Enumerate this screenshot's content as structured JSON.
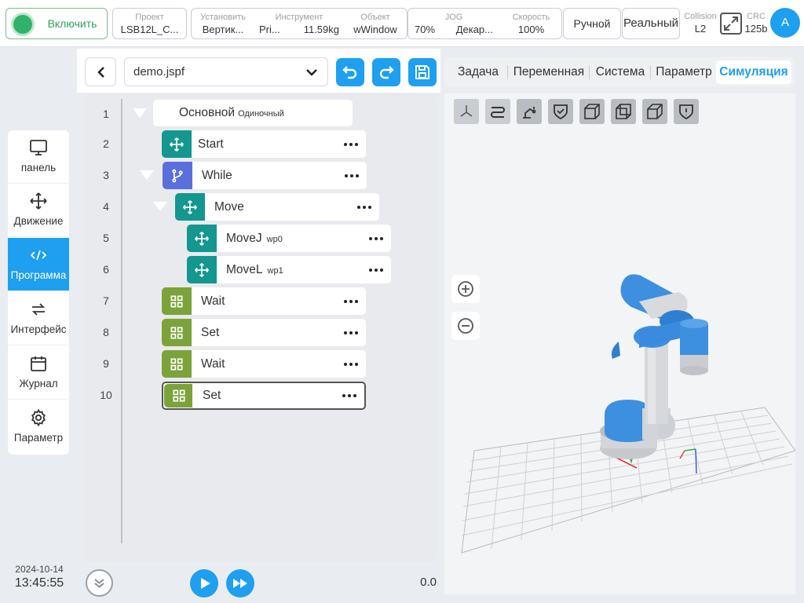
{
  "topbar": {
    "power_label": "Включить",
    "project": {
      "key": "Проект",
      "value": "LSB12L_C..."
    },
    "install": {
      "key": "Установить",
      "value": "Вертик..."
    },
    "tool": {
      "key": "Инструмент",
      "value_a": "Pri...",
      "value_b": "11.59kg"
    },
    "object": {
      "key": "Объект",
      "value": "wWindow"
    },
    "jog": {
      "key": "JOG",
      "value_a": "70%",
      "value_b": "Декар..."
    },
    "speed": {
      "key": "Скорость",
      "value": "100%"
    },
    "mode_label": "Ручной",
    "real_label": "Реальный",
    "collision": {
      "key": "Collision",
      "value": "L2"
    },
    "crc": {
      "key": "CRC",
      "value": "125b"
    },
    "avatar_letter": "A"
  },
  "nav": {
    "items": [
      {
        "label": "панель",
        "icon": "monitor-icon"
      },
      {
        "label": "Движение",
        "icon": "move-icon"
      },
      {
        "label": "Программа",
        "icon": "code-icon"
      },
      {
        "label": "Интерфейс",
        "icon": "swap-icon"
      },
      {
        "label": "Журнал",
        "icon": "calendar-icon"
      },
      {
        "label": "Параметр",
        "icon": "gear-icon"
      }
    ],
    "active": "Программа"
  },
  "datetime": {
    "date": "2024-10-14",
    "time": "13:45:55"
  },
  "editor": {
    "file_name": "demo.jspf",
    "line_numbers": [
      "1",
      "2",
      "3",
      "4",
      "5",
      "6",
      "7",
      "8",
      "9",
      "10"
    ],
    "root": {
      "label": "Основной",
      "sub": "Одиночный"
    },
    "nodes": [
      {
        "label": "Start",
        "sub": ""
      },
      {
        "label": "While",
        "sub": ""
      },
      {
        "label": "Move",
        "sub": ""
      },
      {
        "label": "MoveJ",
        "sub": "wp0"
      },
      {
        "label": "MoveL",
        "sub": "wp1"
      },
      {
        "label": "Wait",
        "sub": ""
      },
      {
        "label": "Set",
        "sub": ""
      },
      {
        "label": "Wait",
        "sub": ""
      },
      {
        "label": "Set",
        "sub": ""
      }
    ],
    "progress_value": "0.0"
  },
  "tabs": {
    "items": [
      "Задача",
      "Переменная",
      "Система",
      "Параметр",
      "Симуляция"
    ],
    "active": "Симуляция"
  },
  "colors": {
    "accent": "#1e9ff0",
    "move_node": "#13978e",
    "while_node": "#5a6fdc",
    "misc_node": "#7ba33a",
    "power_on": "#2fb36a",
    "robot_blue": "#3d8fe0"
  }
}
